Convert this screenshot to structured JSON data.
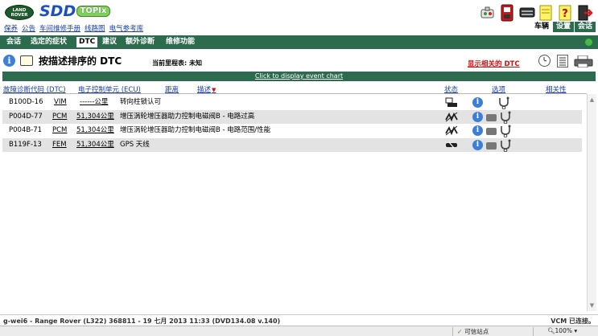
{
  "header": {
    "logo_text": "LAND ROVER",
    "app_name": "SDD",
    "topix_label": "TOPIx",
    "links": [
      "保养",
      "公告",
      "车间维修手册",
      "线路图",
      "电气参考库"
    ],
    "right_tabs": [
      {
        "label": "车辆",
        "active": true
      },
      {
        "label": "设置",
        "active": false
      },
      {
        "label": "会话",
        "active": false
      }
    ]
  },
  "tabs": [
    {
      "label": "会话",
      "active": false
    },
    {
      "label": "选定的症状",
      "active": false
    },
    {
      "label": "DTC",
      "active": true
    },
    {
      "label": "建议",
      "active": false
    },
    {
      "label": "额外诊断",
      "active": false
    },
    {
      "label": "维修功能",
      "active": false
    }
  ],
  "titlebar": {
    "title": "按描述排序的 DTC",
    "mileage": "当前里程表: 未知",
    "show_related": "显示相关的 DTC"
  },
  "event_chart_link": "Click to display event chart",
  "table": {
    "headers": {
      "dtc": "故障诊断代码 (DTC)",
      "ecu": "电子控制单元 (ECU)",
      "distance": "距离",
      "description": "描述",
      "status": "状态",
      "options": "选项",
      "relevance": "相关性"
    },
    "rows": [
      {
        "dtc": "B100D-16",
        "ecu": "VIM",
        "distance": "------公里",
        "description": "转向柱锁认可",
        "status_icon": "ecu-status-icon",
        "shaded": false
      },
      {
        "dtc": "P004D-77",
        "ecu": "PCM",
        "distance": "51,304公里",
        "description": "增压涡轮增压器助力控制电磁阀B - 电路过高",
        "status_icon": "intermittent-status-icon",
        "shaded": true
      },
      {
        "dtc": "P004B-71",
        "ecu": "PCM",
        "distance": "51,304公里",
        "description": "增压涡轮增压器助力控制电磁阀B - 电路范围/性能",
        "status_icon": "intermittent-status-icon",
        "shaded": false
      },
      {
        "dtc": "B119F-13",
        "ecu": "FEM",
        "distance": "51,304公里",
        "description": "GPS 天线",
        "status_icon": "open-circuit-status-icon",
        "shaded": true
      }
    ]
  },
  "statusbar": {
    "left": "g-wei6 - Range Rover (L322) 368811 - 19 七月 2013 11:33 (DVD134.08 v.140)",
    "right": "VCM 已连接。"
  },
  "browserbar": {
    "zone": "可信站点",
    "zoom": "100%"
  },
  "colors": {
    "bar_green": "#2d6b4f",
    "link_blue": "#1a3ea8",
    "alert_red": "#d01010",
    "row_shade": "#e3e3e3"
  }
}
